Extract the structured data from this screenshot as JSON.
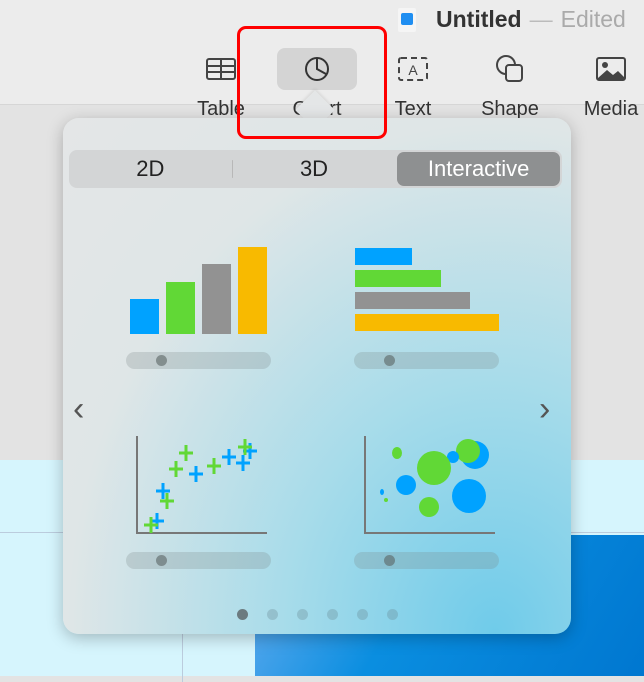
{
  "window": {
    "title": "Untitled",
    "separator": "—",
    "status": "Edited"
  },
  "toolbar": {
    "items": [
      {
        "label": "Table",
        "icon": "table-icon"
      },
      {
        "label": "Chart",
        "icon": "chart-pie-icon",
        "selected": true
      },
      {
        "label": "Text",
        "icon": "text-box-icon"
      },
      {
        "label": "Shape",
        "icon": "shape-icon"
      },
      {
        "label": "Media",
        "icon": "media-icon"
      }
    ]
  },
  "chart_popover": {
    "tabs": [
      {
        "label": "2D"
      },
      {
        "label": "3D"
      },
      {
        "label": "Interactive",
        "active": true
      }
    ],
    "options": [
      "interactive-column-chart",
      "interactive-bar-chart",
      "interactive-scatter-chart",
      "interactive-bubble-chart"
    ],
    "page_count": 6,
    "current_page": 1,
    "colors": {
      "blue": "#00a2ff",
      "green": "#61d836",
      "gray": "#929292",
      "yellow": "#f8ba00"
    }
  }
}
